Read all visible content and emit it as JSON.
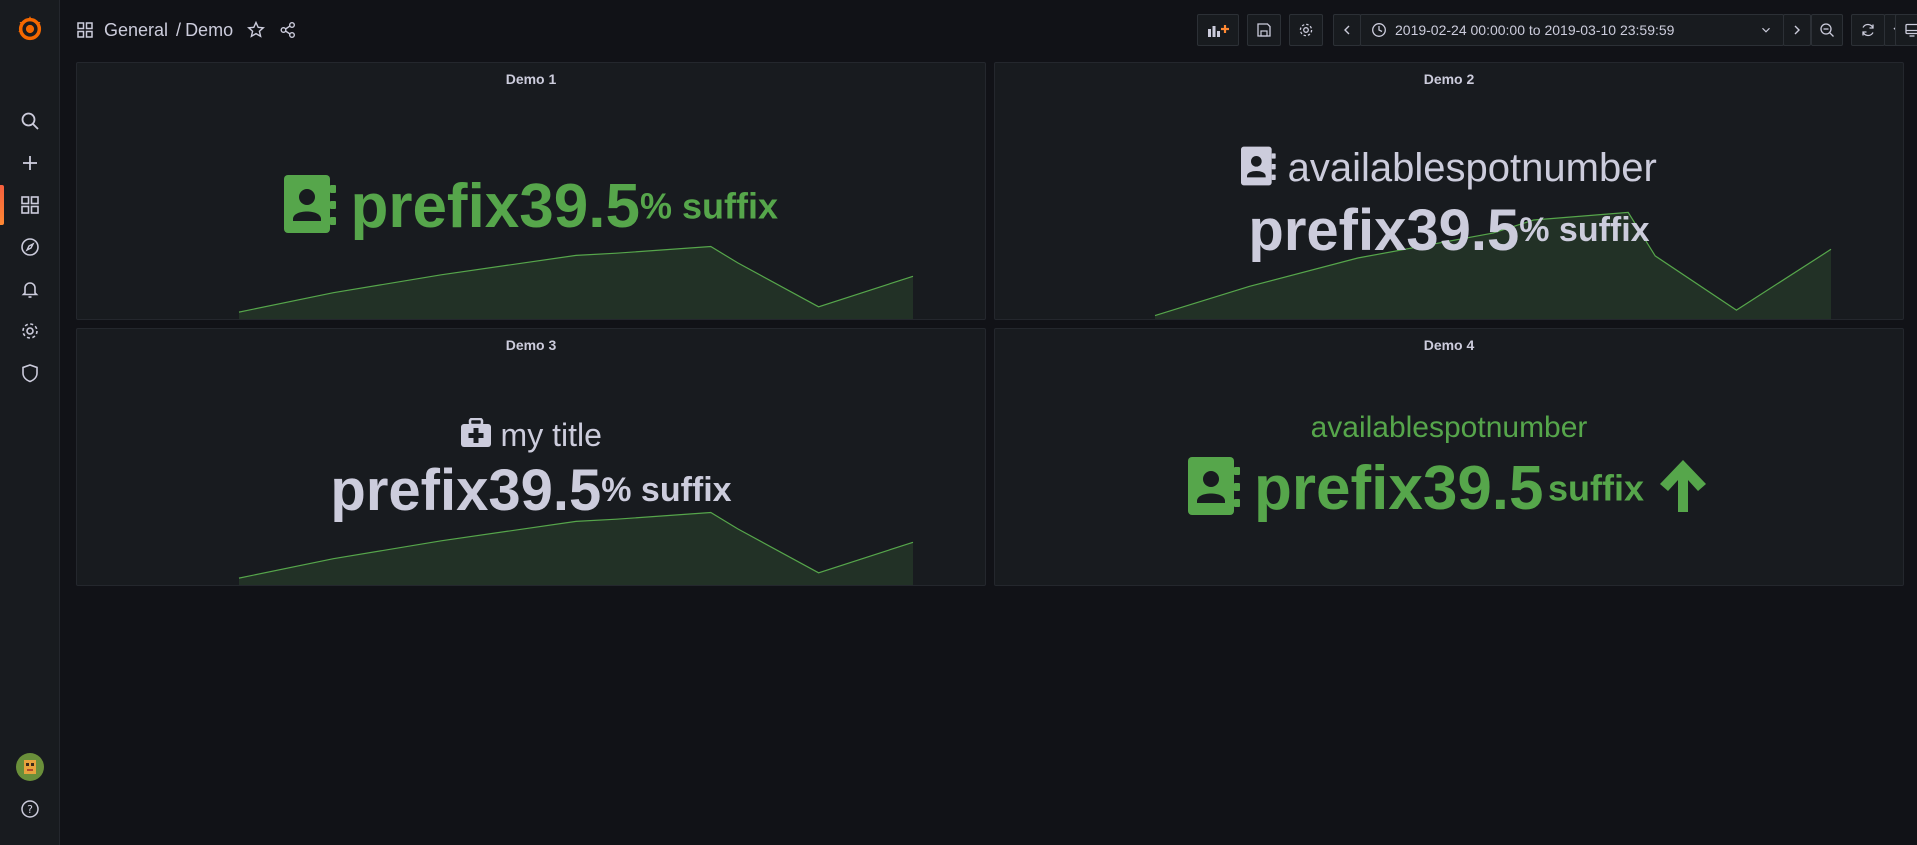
{
  "app": {
    "logo_icon": "grafana-logo-icon",
    "accent": "#f46800"
  },
  "sidebar": {
    "items": [
      {
        "name": "search",
        "icon": "search-icon"
      },
      {
        "name": "create",
        "icon": "plus-icon"
      },
      {
        "name": "dashboards",
        "icon": "dashboards-grid-icon",
        "active": true
      },
      {
        "name": "explore",
        "icon": "compass-icon"
      },
      {
        "name": "alerting",
        "icon": "bell-icon"
      },
      {
        "name": "configuration",
        "icon": "gear-icon"
      },
      {
        "name": "server-admin",
        "icon": "shield-icon"
      }
    ],
    "bottom": [
      {
        "name": "profile",
        "icon": "avatar"
      },
      {
        "name": "help",
        "icon": "help-icon"
      }
    ]
  },
  "breadcrumb": {
    "folder": "General",
    "separator": "/",
    "dashboard": "Demo"
  },
  "toolbar": {
    "time_range": "2019-02-24 00:00:00 to 2019-03-10 23:59:59"
  },
  "colors": {
    "green": "#56a64b",
    "text": "#ccccdc",
    "panel_bg": "#181b1f",
    "page_bg": "#111217"
  },
  "panels": [
    {
      "title": "Demo 1",
      "prefix": "prefix",
      "value": "39.5",
      "unit_suffix": "% suffix",
      "icon": "address-book-icon",
      "color_mode": "green"
    },
    {
      "title": "Demo 2",
      "label": "availablespotnumber",
      "prefix": "prefix",
      "value": "39.5",
      "unit_suffix": "% suffix",
      "icon": "address-book-icon",
      "color_mode": "grey"
    },
    {
      "title": "Demo 3",
      "label": "my title",
      "prefix": "prefix",
      "value": "39.5",
      "unit_suffix": "% suffix",
      "icon": "first-aid-kit-icon",
      "color_mode": "grey"
    },
    {
      "title": "Demo 4",
      "label": "availablespotnumber",
      "prefix": "prefix",
      "value": "39.5",
      "unit_suffix": "suffix",
      "icon": "address-book-icon",
      "trend_icon": "arrow-up-icon",
      "color_mode": "green"
    }
  ],
  "chart_data": [
    {
      "type": "area",
      "title": "Demo 1",
      "values": [
        0.12,
        0.38,
        0.62,
        0.88,
        0.91,
        1.0,
        0.78,
        0.19,
        0.6
      ],
      "ylim": [
        0,
        1.1
      ]
    },
    {
      "type": "area",
      "title": "Demo 2",
      "values": [
        0.05,
        0.32,
        0.58,
        0.81,
        0.93,
        1.0,
        0.6,
        0.1,
        0.66
      ],
      "ylim": [
        0,
        1.05
      ]
    },
    {
      "type": "area",
      "title": "Demo 3",
      "values": [
        0.12,
        0.38,
        0.62,
        0.88,
        0.91,
        1.0,
        0.78,
        0.19,
        0.6
      ],
      "ylim": [
        0,
        1.1
      ]
    }
  ]
}
